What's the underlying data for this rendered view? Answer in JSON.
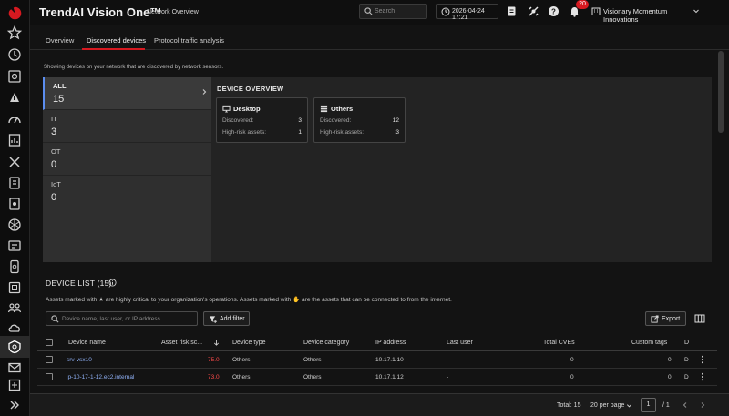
{
  "app": {
    "title": "TrendAI Vision One™",
    "page_name": "Network Overview"
  },
  "topbar": {
    "search_placeholder": "Search",
    "datetime": "2026-04-24 17:21",
    "notification_count": "20",
    "organization": "Visionary Momentum Innovations"
  },
  "tabs": [
    {
      "label": "Overview"
    },
    {
      "label": "Discovered devices"
    },
    {
      "label": "Protocol traffic analysis"
    }
  ],
  "intro": "Showing devices on your network that are discovered by network sensors.",
  "segments": [
    {
      "label": "ALL",
      "count": "15"
    },
    {
      "label": "IT",
      "count": "3"
    },
    {
      "label": "OT",
      "count": "0"
    },
    {
      "label": "IoT",
      "count": "0"
    }
  ],
  "overview": {
    "title": "DEVICE OVERVIEW",
    "cards": [
      {
        "name": "Desktop",
        "discovered_label": "Discovered:",
        "discovered": "3",
        "highrisk_label": "High-risk assets:",
        "highrisk": "1"
      },
      {
        "name": "Others",
        "discovered_label": "Discovered:",
        "discovered": "12",
        "highrisk_label": "High-risk assets:",
        "highrisk": "3"
      }
    ]
  },
  "device_list": {
    "title": "DEVICE LIST (15)",
    "note_pre": "Assets marked with ★ are highly critical to your organization's operations. Assets marked with ",
    "note_post": " are the assets that can be connected to from the internet.",
    "filter_placeholder": "Device name, last user, or IP address",
    "add_filter_label": "Add filter",
    "export_label": "Export"
  },
  "table": {
    "columns": [
      "Device name",
      "Asset risk sc...",
      "Device type",
      "Device category",
      "IP address",
      "Last user",
      "Total CVEs",
      "Custom tags",
      "D"
    ],
    "rows": [
      {
        "name": "srv-vsx10",
        "risk": "75.0",
        "type": "Others",
        "category": "Others",
        "ip": "10.17.1.10",
        "user": "-",
        "cves": "0",
        "tags": "0",
        "d": "D"
      },
      {
        "name": "ip-10-17-1-12.ec2.internal",
        "risk": "73.0",
        "type": "Others",
        "category": "Others",
        "ip": "10.17.1.12",
        "user": "-",
        "cves": "0",
        "tags": "0",
        "d": "D"
      }
    ]
  },
  "footer": {
    "total": "Total: 15",
    "per_page": "20 per page",
    "page": "1",
    "of": "/   1"
  },
  "colors": {
    "accent": "#d71920",
    "link": "#8fb0f5",
    "risk": "#ff4a4a",
    "selected_border": "#5b8def"
  }
}
